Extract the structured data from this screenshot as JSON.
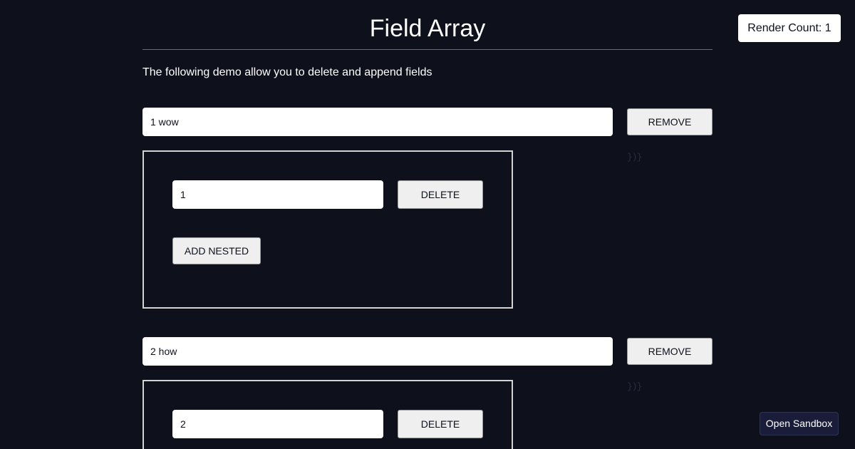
{
  "header": {
    "title": "Field Array",
    "render_count": "Render Count: 1"
  },
  "description": "The following demo allow you to delete and append fields",
  "field_groups": [
    {
      "value": "1 wow",
      "remove_label": "REMOVE",
      "closing_braces": "})}",
      "nested": {
        "value": "1",
        "delete_label": "DELETE",
        "add_nested_label": "ADD NESTED"
      }
    },
    {
      "value": "2 how",
      "remove_label": "REMOVE",
      "closing_braces": "})}",
      "nested": {
        "value": "2",
        "delete_label": "DELETE"
      }
    }
  ],
  "sandbox": {
    "label": "Open Sandbox"
  }
}
